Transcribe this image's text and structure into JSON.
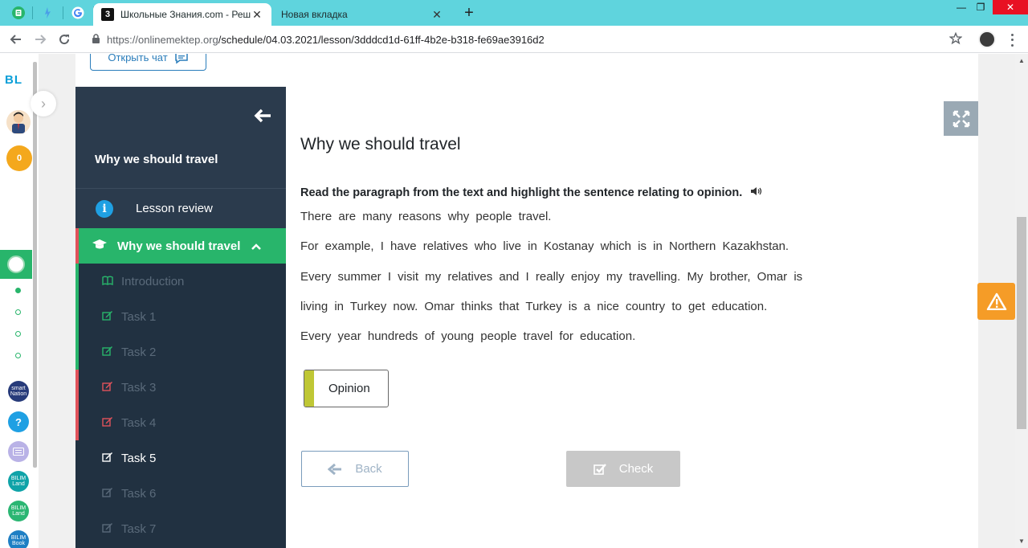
{
  "browser": {
    "tabs": [
      {
        "title": "Школьные Знания.com - Решае",
        "favicon": "3"
      },
      {
        "title": "Новая вкладка"
      }
    ],
    "url_host": "https://onlinemektep.org",
    "url_path": "/schedule/04.03.2021/lesson/3dddcd1d-61ff-4b2e-b318-fe69ae3916d2",
    "new_tab": "+",
    "tab_close": "✕"
  },
  "rail": {
    "logo_part1": "B",
    "logo_part2": "L",
    "points": "0",
    "apps": [
      "smart Nation",
      "?",
      "",
      "BILIM Land",
      "BILIM Land",
      "BILIM Book"
    ]
  },
  "chat": {
    "label": "Открыть чат"
  },
  "sidebar": {
    "title": "Why we should travel",
    "review_label": "Lesson review",
    "section_label": "Why we should travel",
    "items": [
      {
        "label": "Introduction",
        "icon": "book-icon",
        "status_color": "#28b56b"
      },
      {
        "label": "Task 1",
        "icon": "edit-icon",
        "status_color": "#28b56b"
      },
      {
        "label": "Task 2",
        "icon": "edit-icon",
        "status_color": "#28b56b"
      },
      {
        "label": "Task 3",
        "icon": "edit-icon",
        "status_color": "#e0525b"
      },
      {
        "label": "Task 4",
        "icon": "edit-icon",
        "status_color": "#e0525b"
      },
      {
        "label": "Task 5",
        "icon": "edit-icon",
        "status_color": "none"
      },
      {
        "label": "Task 6",
        "icon": "edit-icon",
        "status_color": "none"
      },
      {
        "label": "Task 7",
        "icon": "edit-icon",
        "status_color": "none"
      }
    ]
  },
  "content": {
    "title": "Why we should travel",
    "instruction": "Read the paragraph from the text and highlight the sentence relating to opinion.",
    "lines": [
      "There are many reasons why people travel.",
      "For example, I have relatives who live in Kostanay which is in Northern Kazakhstan.",
      "Every summer I visit my relatives and I really enjoy my travelling. My brother, Omar is",
      "living in Turkey now. Omar thinks that Turkey is a nice country to get education.",
      "Every year hundreds of young people travel for education."
    ],
    "opinion_label": "Opinion",
    "back_label": "Back",
    "check_label": "Check"
  },
  "colors": {
    "accent_green": "#28b56b",
    "sidebar_bg": "#213141",
    "error_red": "#e0525b",
    "warning_orange": "#f59c27",
    "opinion_tag": "#bfc735"
  }
}
